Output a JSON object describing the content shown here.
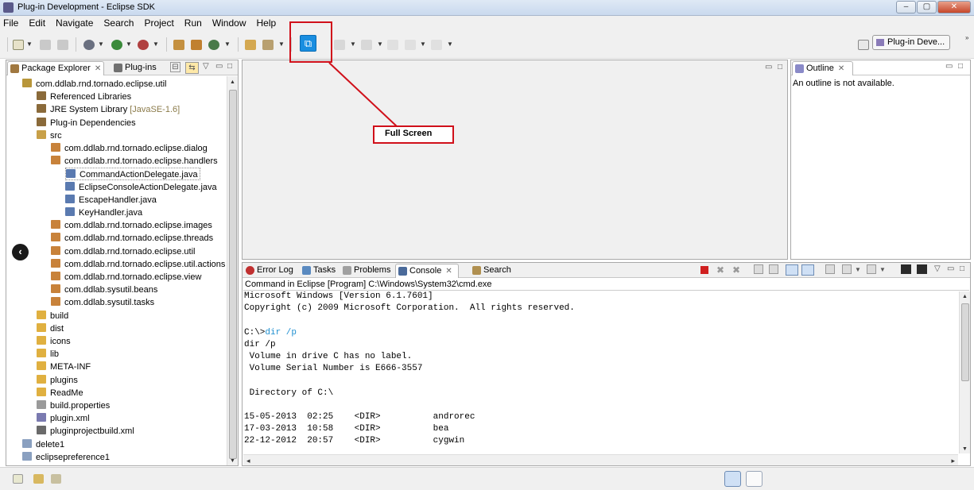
{
  "window": {
    "title": "Plug-in Development - Eclipse SDK",
    "controls": [
      "–",
      "▢",
      "✕"
    ]
  },
  "menu": [
    "File",
    "Edit",
    "Navigate",
    "Search",
    "Project",
    "Run",
    "Window",
    "Help"
  ],
  "toolbar": {
    "full_screen_icon": "full-screen-icon",
    "perspective_label": "Plug-in Deve..."
  },
  "annotation": {
    "label": "Full Screen",
    "color": "#d0101a"
  },
  "package_explorer": {
    "tabs": [
      "Package Explorer",
      "Plug-ins"
    ],
    "tree": [
      {
        "label": "com.ddlab.rnd.tornado.eclipse.util",
        "icon": "project-icon"
      },
      {
        "label": "Referenced Libraries",
        "icon": "library-icon"
      },
      {
        "label": "JRE System Library",
        "suffix": "[JavaSE-1.6]",
        "icon": "library-icon"
      },
      {
        "label": "Plug-in Dependencies",
        "icon": "library-icon"
      },
      {
        "label": "src",
        "icon": "source-folder-icon"
      },
      {
        "label": "com.ddlab.rnd.tornado.eclipse.dialog",
        "icon": "package-icon"
      },
      {
        "label": "com.ddlab.rnd.tornado.eclipse.handlers",
        "icon": "package-icon"
      },
      {
        "label": "CommandActionDelegate.java",
        "icon": "java-file-icon"
      },
      {
        "label": "EclipseConsoleActionDelegate.java",
        "icon": "java-file-icon"
      },
      {
        "label": "EscapeHandler.java",
        "icon": "java-file-icon"
      },
      {
        "label": "KeyHandler.java",
        "icon": "java-file-icon"
      },
      {
        "label": "com.ddlab.rnd.tornado.eclipse.images",
        "icon": "package-icon"
      },
      {
        "label": "com.ddlab.rnd.tornado.eclipse.threads",
        "icon": "package-icon"
      },
      {
        "label": "com.ddlab.rnd.tornado.eclipse.util",
        "icon": "package-icon"
      },
      {
        "label": "com.ddlab.rnd.tornado.eclipse.util.actions",
        "icon": "package-icon"
      },
      {
        "label": "com.ddlab.rnd.tornado.eclipse.view",
        "icon": "package-icon"
      },
      {
        "label": "com.ddlab.sysutil.beans",
        "icon": "package-icon"
      },
      {
        "label": "com.ddlab.sysutil.tasks",
        "icon": "package-icon"
      },
      {
        "label": "build",
        "icon": "folder-icon"
      },
      {
        "label": "dist",
        "icon": "folder-icon"
      },
      {
        "label": "icons",
        "icon": "folder-icon"
      },
      {
        "label": "lib",
        "icon": "folder-icon"
      },
      {
        "label": "META-INF",
        "icon": "folder-icon"
      },
      {
        "label": "plugins",
        "icon": "folder-icon"
      },
      {
        "label": "ReadMe",
        "icon": "folder-icon"
      },
      {
        "label": "build.properties",
        "icon": "file-icon"
      },
      {
        "label": "plugin.xml",
        "icon": "plugin-file-icon"
      },
      {
        "label": "pluginprojectbuild.xml",
        "icon": "xml-file-icon"
      },
      {
        "label": "delete1",
        "icon": "closed-project-icon"
      },
      {
        "label": "eclipsepreference1",
        "icon": "closed-project-icon"
      }
    ]
  },
  "outline": {
    "tab": "Outline",
    "message": "An outline is not available."
  },
  "bottom_panel": {
    "tabs": [
      "Error Log",
      "Tasks",
      "Problems",
      "Console",
      "Search"
    ],
    "console_label": "Command in Eclipse [Program] C:\\Windows\\System32\\cmd.exe",
    "lines": [
      {
        "text": "Microsoft Windows [Version 6.1.7601]"
      },
      {
        "text": "Copyright (c) 2009 Microsoft Corporation.  All rights reserved."
      },
      {
        "text": ""
      },
      {
        "text": "C:\\>",
        "cmd": "dir /p"
      },
      {
        "text": "dir /p"
      },
      {
        "text": " Volume in drive C has no label."
      },
      {
        "text": " Volume Serial Number is E666-3557"
      },
      {
        "text": ""
      },
      {
        "text": " Directory of C:\\"
      },
      {
        "text": ""
      },
      {
        "text": "15-05-2013  02:25    <DIR>          androrec"
      },
      {
        "text": "17-03-2013  10:58    <DIR>          bea"
      },
      {
        "text": "22-12-2012  20:57    <DIR>          cygwin"
      }
    ]
  }
}
